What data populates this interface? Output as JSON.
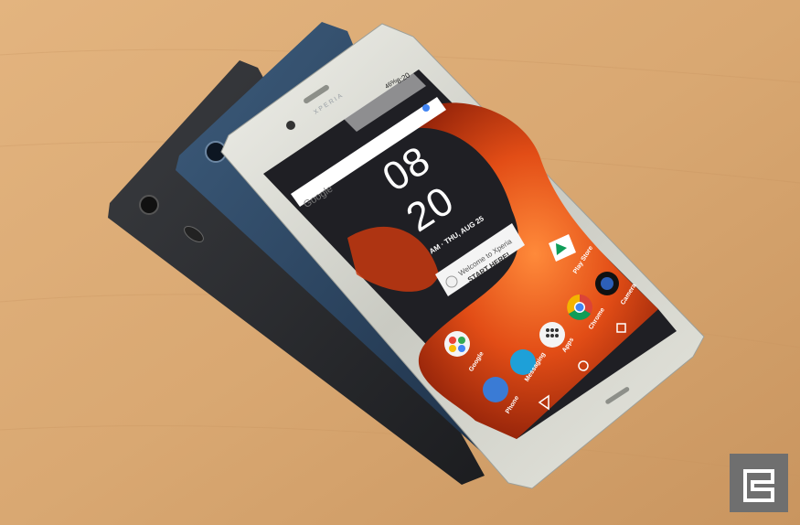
{
  "screen": {
    "status_time": "8:20",
    "battery": "46%",
    "search_widget": "Google",
    "clock_hour": "08",
    "clock_minute": "20",
    "date_line": "AM · THU, AUG 25",
    "welcome_line1": "Welcome to Xperia",
    "welcome_line2": "START HERE!",
    "brand": "XPERIA"
  },
  "apps": {
    "google": "Google",
    "messaging": "Messaging",
    "apps": "Apps",
    "chrome": "Chrome",
    "phone": "Phone",
    "play_store": "Play Store",
    "camera": "Camera"
  },
  "colors": {
    "table": "#d9a872",
    "phone_front": "#cfd0c8",
    "phone_blue": "#2f4a66",
    "phone_black": "#2b2d31",
    "wallpaper_orange": "#e8531b",
    "wallpaper_dark": "#1f1f24",
    "watermark": "#6f6f6f"
  },
  "icons": [
    "google-folder-icon",
    "messaging-icon",
    "apps-icon",
    "chrome-icon",
    "phone-icon",
    "play-store-icon",
    "camera-icon",
    "back-icon",
    "home-icon",
    "recents-icon",
    "microphone-icon",
    "engadget-logo-icon"
  ]
}
